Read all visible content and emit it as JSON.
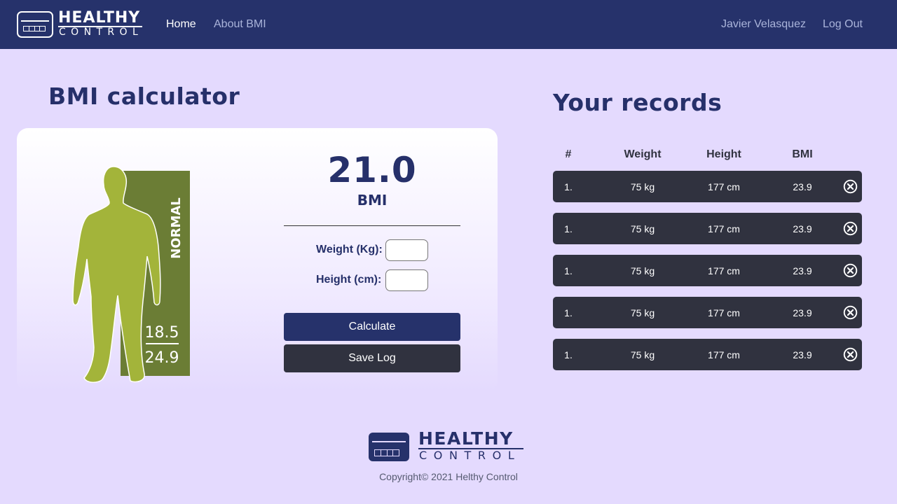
{
  "brand": {
    "word1": "HEALTHY",
    "word2": "CONTROL"
  },
  "nav": {
    "home": "Home",
    "about": "About BMI",
    "user": "Javier Velasquez",
    "logout": "Log Out"
  },
  "calculator": {
    "title": "BMI calculator",
    "bmi_value": "21.0",
    "bmi_label": "BMI",
    "figure": {
      "category": "NORMAL",
      "range_low": "18.5",
      "range_high": "24.9"
    },
    "weight_label": "Weight (Kg):",
    "weight_value": "",
    "height_label": "Height (cm):",
    "height_value": "",
    "calculate_label": "Calculate",
    "save_label": "Save Log"
  },
  "records": {
    "title": "Your records",
    "columns": [
      "#",
      "Weight",
      "Height",
      "BMI"
    ],
    "rows": [
      {
        "num": "1.",
        "weight": "75 kg",
        "height": "177 cm",
        "bmi": "23.9"
      },
      {
        "num": "1.",
        "weight": "75 kg",
        "height": "177 cm",
        "bmi": "23.9"
      },
      {
        "num": "1.",
        "weight": "75 kg",
        "height": "177 cm",
        "bmi": "23.9"
      },
      {
        "num": "1.",
        "weight": "75 kg",
        "height": "177 cm",
        "bmi": "23.9"
      },
      {
        "num": "1.",
        "weight": "75 kg",
        "height": "177 cm",
        "bmi": "23.9"
      }
    ],
    "delete_icon": "close-circle-icon"
  },
  "footer": {
    "word1": "HEALTHY",
    "word2": "CONTROL",
    "copyright": "Copyright© 2021 Helthy Control"
  },
  "colors": {
    "navbar": "#26326b",
    "background": "#e4dafe",
    "row": "#30323f",
    "figure_body": "#a3b43a",
    "figure_band": "#6b7d35"
  }
}
